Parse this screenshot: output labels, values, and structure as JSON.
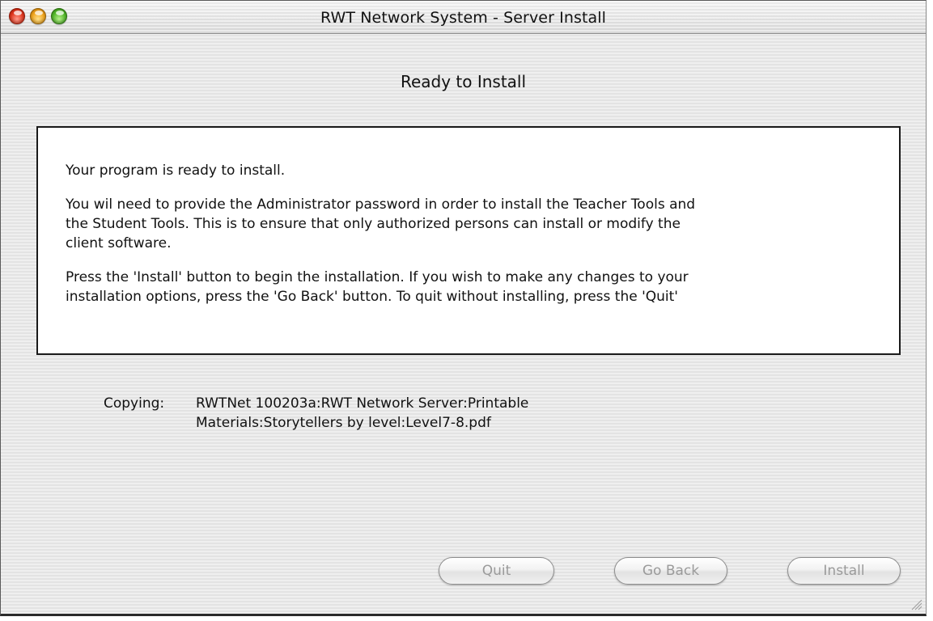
{
  "window": {
    "title": "RWT Network System - Server Install"
  },
  "page": {
    "heading": "Ready to Install"
  },
  "message": {
    "paragraphs": [
      "Your program is ready to install.",
      "You wil need to provide the Administrator password in order to install the Teacher Tools and\nthe Student Tools.  This is to ensure that only authorized persons can install or modify the\nclient software.",
      "Press the 'Install' button to begin the installation.  If you wish to make any changes to your\ninstallation options, press the 'Go Back' button.  To quit without installing, press the 'Quit'"
    ]
  },
  "status": {
    "label": "Copying:",
    "path": "RWTNet 100203a:RWT Network Server:Printable\nMaterials:Storytellers by level:Level7-8.pdf"
  },
  "buttons": {
    "quit": "Quit",
    "go_back": "Go Back",
    "install": "Install"
  },
  "icons": {
    "close": "close-window-icon",
    "minimize": "minimize-window-icon",
    "zoom": "zoom-window-icon",
    "resize": "resize-grip-icon"
  },
  "colors": {
    "close": "#e0361e",
    "minimize": "#f0a41c",
    "zoom": "#52b82a",
    "disabled_text": "#9a9a9a"
  }
}
